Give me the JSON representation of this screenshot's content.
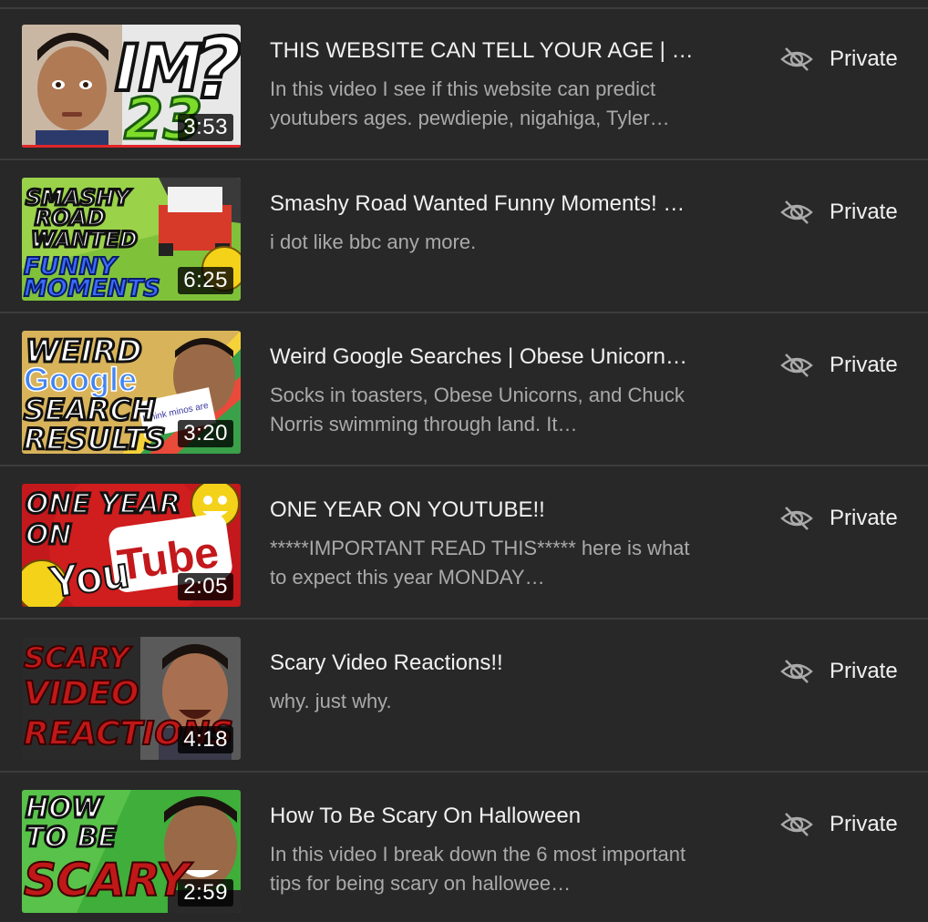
{
  "visibility_icon": "eye-off-icon",
  "colors": {
    "background": "#282828",
    "divider": "#3c3c3c",
    "title": "#f1f1f1",
    "description": "#aaaaaa",
    "progress_red": "#e1262b"
  },
  "videos": [
    {
      "thumbnail_text": [
        "IM",
        "23",
        "?"
      ],
      "duration": "3:53",
      "title": "THIS WEBSITE CAN TELL YOUR AGE | G…",
      "description": "In this video I see if this website can predict youtubers ages. pewdiepie, nigahiga, Tyler…",
      "visibility": "Private"
    },
    {
      "thumbnail_text": [
        "SMASHY",
        "ROAD",
        "WANTED",
        "FUNNY",
        "MOMENTS"
      ],
      "duration": "6:25",
      "title": "Smashy Road Wanted Funny Moments! …",
      "description": "i dot like bbc any more.",
      "visibility": "Private"
    },
    {
      "thumbnail_text": [
        "WEIRD",
        "Google",
        "SEARCH",
        "RESULTS",
        "I think minos are"
      ],
      "duration": "3:20",
      "title": "Weird Google Searches | Obese Unicorn…",
      "description": "Socks in toasters, Obese Unicorns, and Chuck Norris swimming through land. It…",
      "visibility": "Private"
    },
    {
      "thumbnail_text": [
        "ONE YEAR",
        "ON",
        "You",
        "Tube"
      ],
      "duration": "2:05",
      "title": "ONE YEAR ON YOUTUBE!!",
      "description": "*****IMPORTANT READ THIS***** here is what to expect this year MONDAY…",
      "visibility": "Private"
    },
    {
      "thumbnail_text": [
        "SCARY",
        "VIDEO",
        "REACTIONS"
      ],
      "duration": "4:18",
      "title": "Scary Video Reactions!!",
      "description": "why. just why.",
      "visibility": "Private"
    },
    {
      "thumbnail_text": [
        "HOW",
        "TO BE",
        "SCARY"
      ],
      "duration": "2:59",
      "title": "How To Be Scary On Halloween",
      "description": "In this video I break down the 6 most important tips for being scary on hallowee…",
      "visibility": "Private"
    }
  ]
}
